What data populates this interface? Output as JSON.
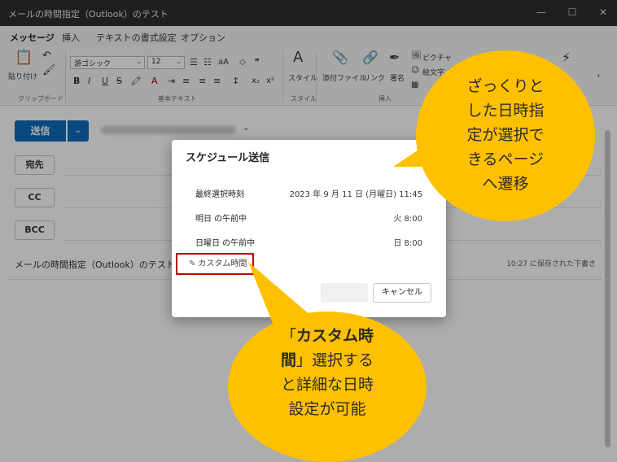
{
  "window": {
    "title": "メールの時間指定（Outlook）のテスト",
    "controls": [
      "—",
      "☐",
      "✕"
    ]
  },
  "ribbon_tabs": [
    {
      "label": "メッセージ",
      "active": true
    },
    {
      "label": "挿入",
      "active": false
    },
    {
      "label": "テキストの書式設定",
      "active": false
    },
    {
      "label": "オプション",
      "active": false
    }
  ],
  "ribbon": {
    "paste_label": "貼り付け",
    "clipboard_group": "クリップボード",
    "font_name": "游ゴシック",
    "font_size": "12",
    "basic_text_group": "基本テキスト",
    "style_label": "スタイル",
    "style_group": "スタイル",
    "attach_label": "添付ファイル",
    "link_label": "リンク",
    "signature_label": "署名",
    "picture_label": "ピクチャ",
    "emoji_label": "絵文字",
    "insert_group": "挿入",
    "format_icons": [
      "B",
      "I",
      "U",
      "S"
    ],
    "subscript": "x₂",
    "superscript": "x²"
  },
  "compose": {
    "send_label": "送信",
    "to_label": "宛先",
    "cc_label": "CC",
    "bcc_label": "BCC",
    "subject": "メールの時間指定（Outlook）のテスト",
    "saved_status": "10:27 に保存された下書き"
  },
  "dialog": {
    "title": "スケジュール送信",
    "options": [
      {
        "label": "最終選択時刻",
        "value": "2023 年 9 月 11 日 (月曜日) 11:45"
      },
      {
        "label": "明日 の午前中",
        "value": "火 8:00"
      },
      {
        "label": "日曜日 の午前中",
        "value": "日 8:00"
      }
    ],
    "custom_time_label": "カスタム時間",
    "cancel_label": "キャンセル"
  },
  "callouts": {
    "top_right": [
      "ざっくりと",
      "した日時指",
      "定が選択で",
      "きるページ",
      "へ遷移"
    ],
    "bottom": {
      "line1_prefix": "「",
      "line1_bold": "カスタム時",
      "line2_bold": "間",
      "line2_rest": "」選択する",
      "line3": "と詳細な日時",
      "line4": "設定が可能"
    }
  },
  "colors": {
    "accent": "#0f6cbd",
    "callout": "#ffc000",
    "highlight_border": "#c00000"
  }
}
